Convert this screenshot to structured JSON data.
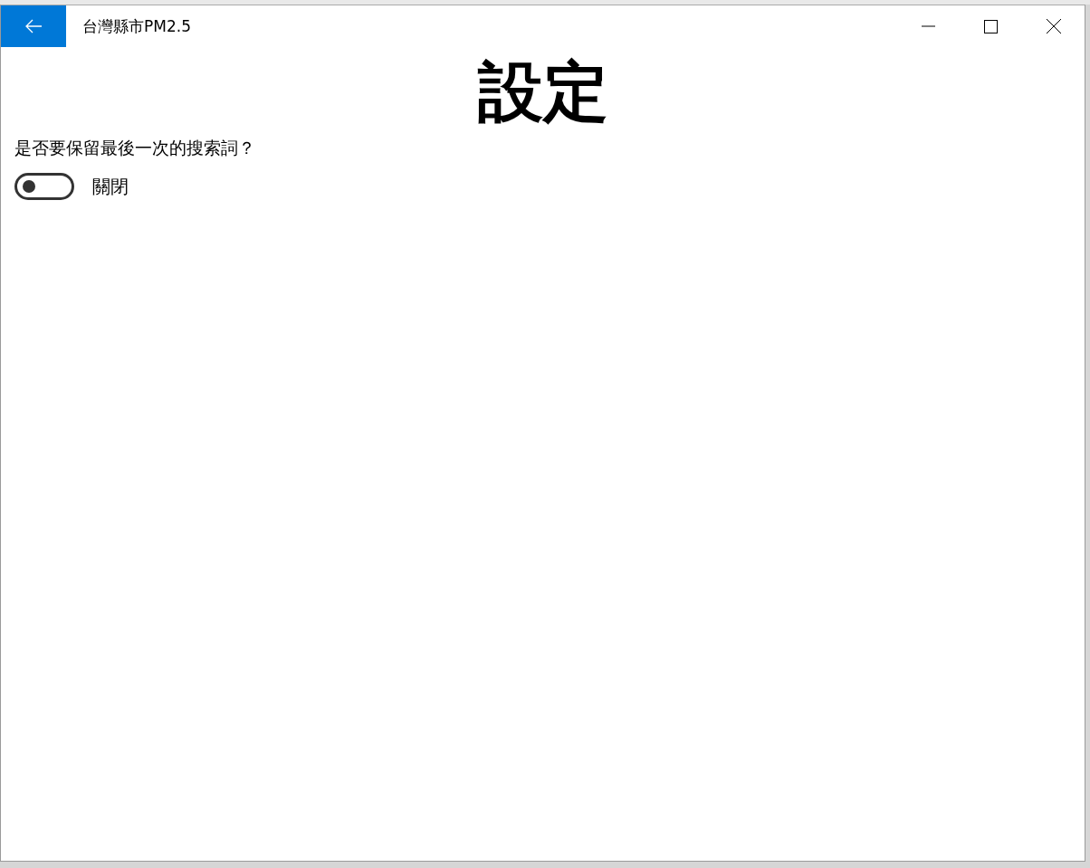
{
  "window": {
    "title": "台灣縣市PM2.5"
  },
  "page": {
    "heading": "設定"
  },
  "settings": [
    {
      "kind": "toggle",
      "question": "是否要保留最後一次的搜索詞？",
      "on": false,
      "state_label": "關閉"
    }
  ]
}
